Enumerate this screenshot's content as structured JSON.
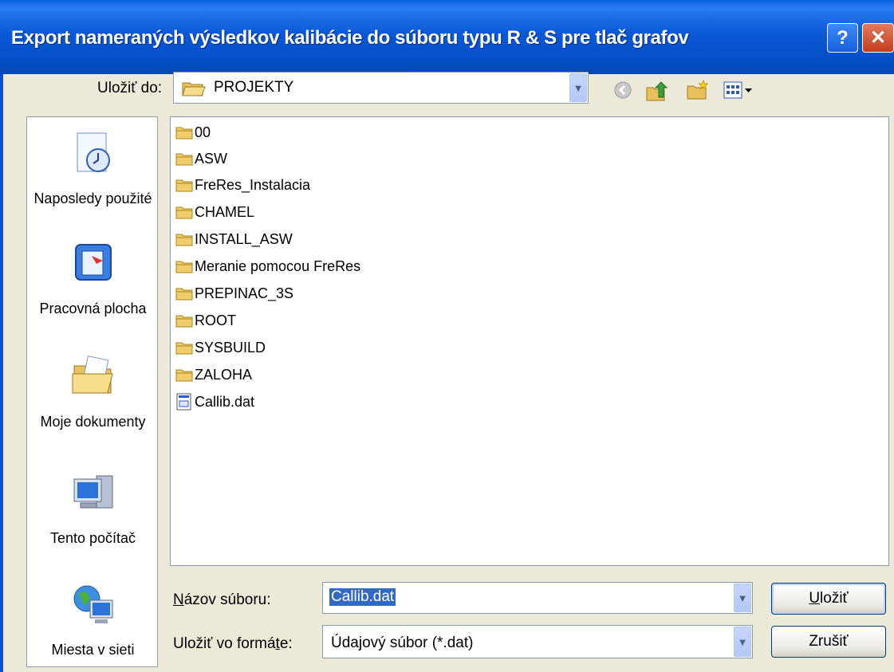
{
  "window": {
    "title": "Export nameraných výsledkov kalibácie do súboru typu R & S pre tlač grafov",
    "help_label": "?",
    "close_label": "✕"
  },
  "lookin": {
    "label": "Uložiť do:",
    "value": "PROJEKTY"
  },
  "toolbar": {
    "icons": [
      "back-icon",
      "up-folder-icon",
      "new-folder-icon",
      "view-menu-icon"
    ]
  },
  "places": [
    {
      "label": "Naposledy použité",
      "icon": "recent-icon"
    },
    {
      "label": "Pracovná plocha",
      "icon": "desktop-icon"
    },
    {
      "label": "Moje dokumenty",
      "icon": "my-documents-icon"
    },
    {
      "label": "Tento počítač",
      "icon": "my-computer-icon"
    },
    {
      "label": "Miesta v sieti",
      "icon": "network-icon"
    }
  ],
  "files": [
    {
      "name": "00",
      "type": "folder"
    },
    {
      "name": "ASW",
      "type": "folder"
    },
    {
      "name": "FreRes_Instalacia",
      "type": "folder"
    },
    {
      "name": "CHAMEL",
      "type": "folder"
    },
    {
      "name": "INSTALL_ASW",
      "type": "folder"
    },
    {
      "name": "Meranie pomocou FreRes",
      "type": "folder"
    },
    {
      "name": "PREPINAC_3S",
      "type": "folder"
    },
    {
      "name": "ROOT",
      "type": "folder"
    },
    {
      "name": "SYSBUILD",
      "type": "folder"
    },
    {
      "name": "ZALOHA",
      "type": "folder"
    },
    {
      "name": "Callib.dat",
      "type": "file"
    }
  ],
  "filename": {
    "label_prefix": "N",
    "label_rest": "ázov súboru:",
    "value": "Callib.dat"
  },
  "filetype": {
    "label_prefix": "Uložiť vo formá",
    "label_u": "t",
    "label_rest": "e:",
    "value": "Údajový súbor (*.dat)"
  },
  "buttons": {
    "save_u": "U",
    "save_rest": "ložiť",
    "cancel": "Zrušiť"
  },
  "colors": {
    "titlebar": "#0a58d6",
    "face": "#ece9d8",
    "selection": "#316ac5"
  }
}
